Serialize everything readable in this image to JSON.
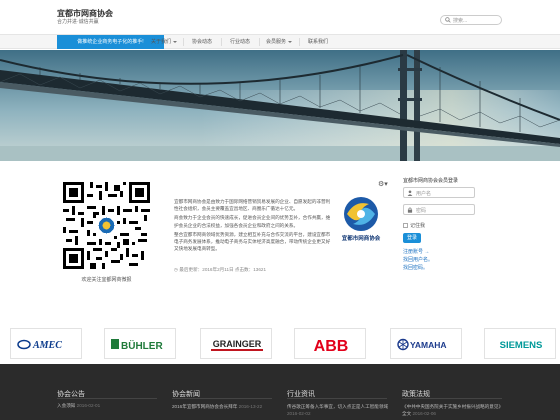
{
  "header": {
    "site_title": "宜都市网商协会",
    "slogan": "合力并进·诚信共赢",
    "search_placeholder": "搜索..."
  },
  "nav": {
    "items": [
      {
        "label": "做推统企业商务电子化的推手!",
        "active": true
      },
      {
        "label": "关于我们",
        "dropdown": true
      },
      {
        "label": "协会动态"
      },
      {
        "label": "行业动态"
      },
      {
        "label": "会员服务",
        "dropdown": true
      },
      {
        "label": "联系我们"
      }
    ]
  },
  "qr": {
    "caption": "欢迎关注宜都网商微报"
  },
  "intro": {
    "paragraphs": [
      "宜都市网商协会是由致力于国际网络营销贸易发展的企业、自愿发起的非营利性社会组织，会员主要覆盖宜昌地区、商圈乐广循达十亿元。",
      "商会致力于企业会员的快速成长，促进会员企业间的优势互补，合作共赢，维护会员企业的合法权益，加强各会员企业和政府之间的关系。",
      "整合宜都市网商领域优势资源，建立相互补充与合作交流的平台，建设宜都市电子商务发展体系，推动电子商务与实体经济高度融合，带动传统企业更又好又快地发展电商转型。"
    ],
    "meta": "最后更新：2016年2月11日    点击数：13621"
  },
  "logo": {
    "text": "宜都市网商协会"
  },
  "login": {
    "title": "宜都市网商协会会员登录",
    "username_placeholder": "用户名",
    "password_placeholder": "密码",
    "remember_label": "记住我",
    "login_button": "登录",
    "links": [
      "注册账号 →",
      "找回用户名。",
      "找回密码。"
    ]
  },
  "partners": [
    {
      "name": "AMEC",
      "color": "#0b3b8c"
    },
    {
      "name": "BÜHLER",
      "color": "#1f7a3a"
    },
    {
      "name": "GRAINGER",
      "color": "#c0151f"
    },
    {
      "name": "ABB",
      "color": "#e2001a"
    },
    {
      "name": "YAMAHA",
      "color": "#1b3a8c"
    },
    {
      "name": "SIEMENS",
      "color": "#009999"
    }
  ],
  "footer": {
    "columns": [
      {
        "title": "协会公告",
        "items": [
          {
            "text": "入会须知",
            "date": "2016-02-01"
          }
        ]
      },
      {
        "title": "协会新闻",
        "items": [
          {
            "text": "2016年宜都市网商协会会长拜年",
            "date": "2016-13-22"
          }
        ]
      },
      {
        "title": "行业资讯",
        "items": [
          {
            "text": "传谷歌正筹备入华事宜，切入点正是人工智能领域",
            "date": "2016-02-02"
          }
        ]
      },
      {
        "title": "政策法规",
        "items": [
          {
            "text": "《中共中央国务院关于实施乡村振兴战略的意见》全文",
            "date": "2016-02-06"
          }
        ]
      }
    ]
  }
}
